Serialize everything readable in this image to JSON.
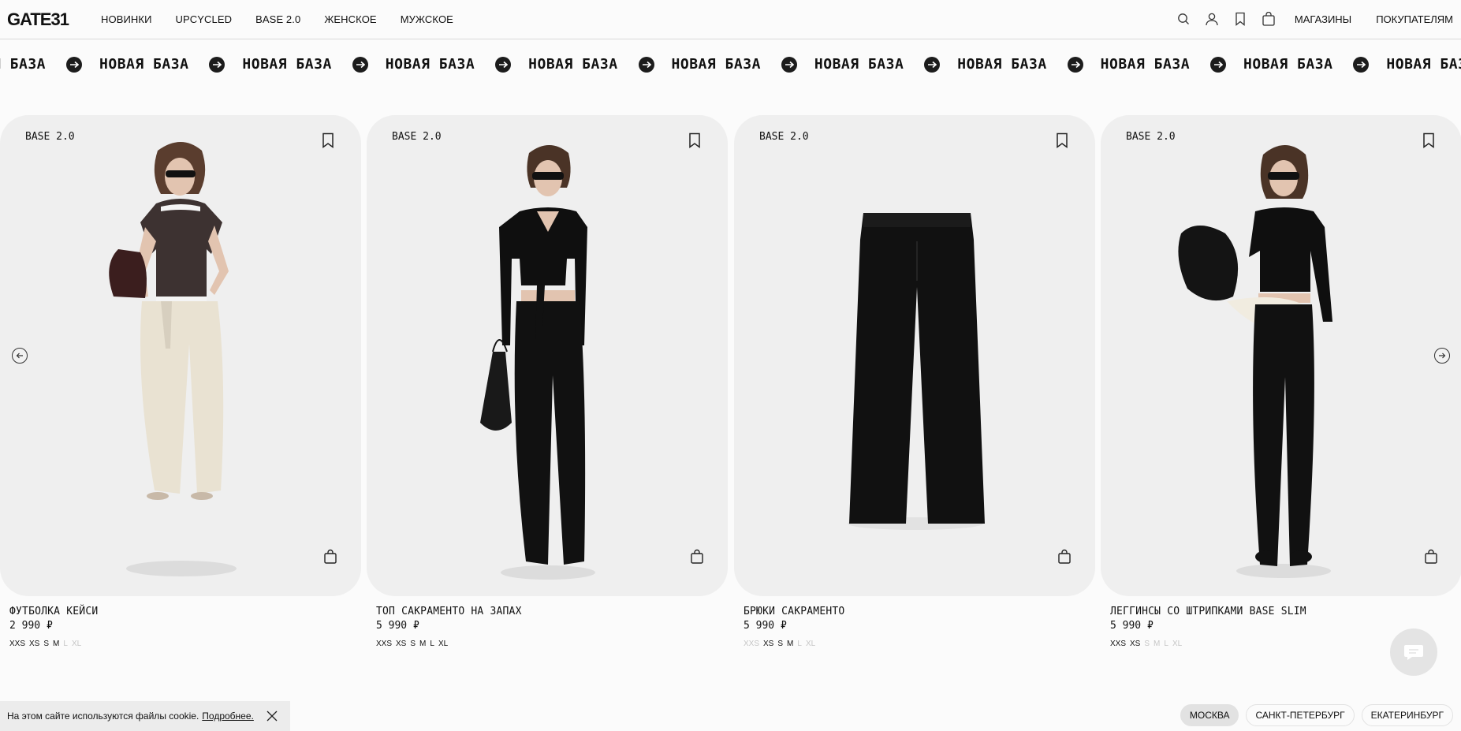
{
  "header": {
    "logo": "GATE31",
    "nav": [
      "НОВИНКИ",
      "UPCYCLED",
      "BASE 2.0",
      "ЖЕНСКОЕ",
      "МУЖСКОЕ"
    ],
    "links": [
      "МАГАЗИНЫ",
      "ПОКУПАТЕЛЯМ"
    ],
    "icons": [
      "search-icon",
      "user-icon",
      "bookmark-icon",
      "bag-icon"
    ]
  },
  "ticker": {
    "first": "Я БАЗА",
    "text": "НОВАЯ БАЗА"
  },
  "products": [
    {
      "badge": "BASE 2.0",
      "name": "ФУТБОЛКА КЕЙСИ",
      "price": "2 990 ₽",
      "sizes": [
        {
          "label": "XXS",
          "available": true
        },
        {
          "label": "XS",
          "available": true
        },
        {
          "label": "S",
          "available": true
        },
        {
          "label": "M",
          "available": true
        },
        {
          "label": "L",
          "available": false
        },
        {
          "label": "XL",
          "available": false
        }
      ]
    },
    {
      "badge": "BASE 2.0",
      "name": "ТОП САКРАМЕНТО НА ЗАПАХ",
      "price": "5 990 ₽",
      "sizes": [
        {
          "label": "XXS",
          "available": true
        },
        {
          "label": "XS",
          "available": true
        },
        {
          "label": "S",
          "available": true
        },
        {
          "label": "M",
          "available": true
        },
        {
          "label": "L",
          "available": true
        },
        {
          "label": "XL",
          "available": true
        }
      ]
    },
    {
      "badge": "BASE 2.0",
      "name": "БРЮКИ САКРАМЕНТО",
      "price": "5 990 ₽",
      "sizes": [
        {
          "label": "XXS",
          "available": false
        },
        {
          "label": "XS",
          "available": true
        },
        {
          "label": "S",
          "available": true
        },
        {
          "label": "M",
          "available": true
        },
        {
          "label": "L",
          "available": false
        },
        {
          "label": "XL",
          "available": false
        }
      ]
    },
    {
      "badge": "BASE 2.0",
      "name": "ЛЕГГИНСЫ СО ШТРИПКАМИ BASE SLIM",
      "price": "5 990 ₽",
      "sizes": [
        {
          "label": "XXS",
          "available": true
        },
        {
          "label": "XS",
          "available": true
        },
        {
          "label": "S",
          "available": false
        },
        {
          "label": "M",
          "available": false
        },
        {
          "label": "L",
          "available": false
        },
        {
          "label": "XL",
          "available": false
        }
      ]
    }
  ],
  "cookie": {
    "text": "На этом сайте используются файлы cookie.",
    "link": "Подробнее."
  },
  "cities": [
    {
      "label": "МОСКВА",
      "active": true
    },
    {
      "label": "САНКТ-ПЕТЕРБУРГ",
      "active": false
    },
    {
      "label": "ЕКАТЕРИНБУРГ",
      "active": false
    }
  ],
  "colors": {
    "background": "#fbfbfb",
    "card": "#efefef",
    "text": "#111111",
    "unavailable": "#c6c6c6"
  }
}
